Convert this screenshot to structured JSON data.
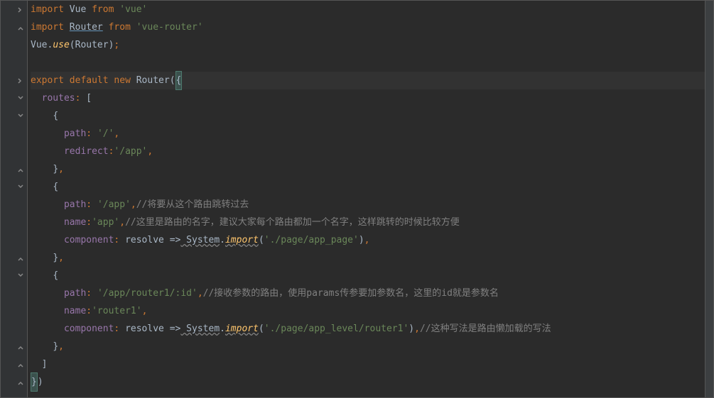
{
  "code": {
    "l1_import": "import",
    "l1_vue": " Vue ",
    "l1_from": "from",
    "l1_vue_str": " 'vue'",
    "l2_import": "import",
    "l2_router": "Router",
    "l2_from": " from",
    "l2_str": " 'vue-router'",
    "l3_vue": "Vue.",
    "l3_use": "use",
    "l3_open": "(",
    "l3_router": "Router",
    "l3_close": ")",
    "l3_semi": ";",
    "l5_export": "export",
    "l5_default": " default",
    "l5_new": " new",
    "l5_router": " Router",
    "l5_open": "(",
    "l5_brace": "{",
    "l6_indent": "  ",
    "l6_routes": "routes",
    "l6_colon": ": ",
    "l6_bracket": "[",
    "l7_indent": "    ",
    "l7_brace": "{",
    "l8_indent": "      ",
    "l8_path": "path",
    "l8_colon": ": ",
    "l8_str": "'/'",
    "l8_comma": ",",
    "l9_indent": "      ",
    "l9_redirect": "redirect",
    "l9_colon": ":",
    "l9_str": "'/app'",
    "l9_comma": ",",
    "l10_indent": "    ",
    "l10_brace": "}",
    "l10_comma": ",",
    "l11_indent": "    ",
    "l11_brace": "{",
    "l12_indent": "      ",
    "l12_path": "path",
    "l12_colon": ": ",
    "l12_str": "'/app'",
    "l12_comma": ",",
    "l12_comment": "//将要从这个路由跳转过去",
    "l13_indent": "      ",
    "l13_name": "name",
    "l13_colon": ":",
    "l13_str": "'app'",
    "l13_comma": ",",
    "l13_comment": "//这里是路由的名字，建议大家每个路由都加一个名字，这样跳转的时候比较方便",
    "l14_indent": "      ",
    "l14_component": "component",
    "l14_colon": ": ",
    "l14_resolve": "resolve ",
    "l14_arrow": "=>",
    "l14_system": " System",
    "l14_dot": ".",
    "l14_import": "import",
    "l14_open": "(",
    "l14_str": "'./page/app_page'",
    "l14_close": ")",
    "l14_comma": ",",
    "l15_indent": "    ",
    "l15_brace": "}",
    "l15_comma": ",",
    "l16_indent": "    ",
    "l16_brace": "{",
    "l17_indent": "      ",
    "l17_path": "path",
    "l17_colon": ": ",
    "l17_str": "'/app/router1/:id'",
    "l17_comma": ",",
    "l17_comment": "//接收参数的路由，使用params传参要加参数名，这里的id就是参数名",
    "l18_indent": "      ",
    "l18_name": "name",
    "l18_colon": ":",
    "l18_str": "'router1'",
    "l18_comma": ",",
    "l19_indent": "      ",
    "l19_component": "component",
    "l19_colon": ": ",
    "l19_resolve": "resolve ",
    "l19_arrow": "=>",
    "l19_system": " System",
    "l19_dot": ".",
    "l19_import": "import",
    "l19_open": "(",
    "l19_str": "'./page/app_level/router1'",
    "l19_close": ")",
    "l19_comma": ",",
    "l19_comment": "//这种写法是路由懒加载的写法",
    "l20_indent": "    ",
    "l20_brace": "}",
    "l20_comma": ",",
    "l21_indent": "  ",
    "l21_bracket": "]",
    "l22_brace": "}",
    "l22_close": ")"
  }
}
